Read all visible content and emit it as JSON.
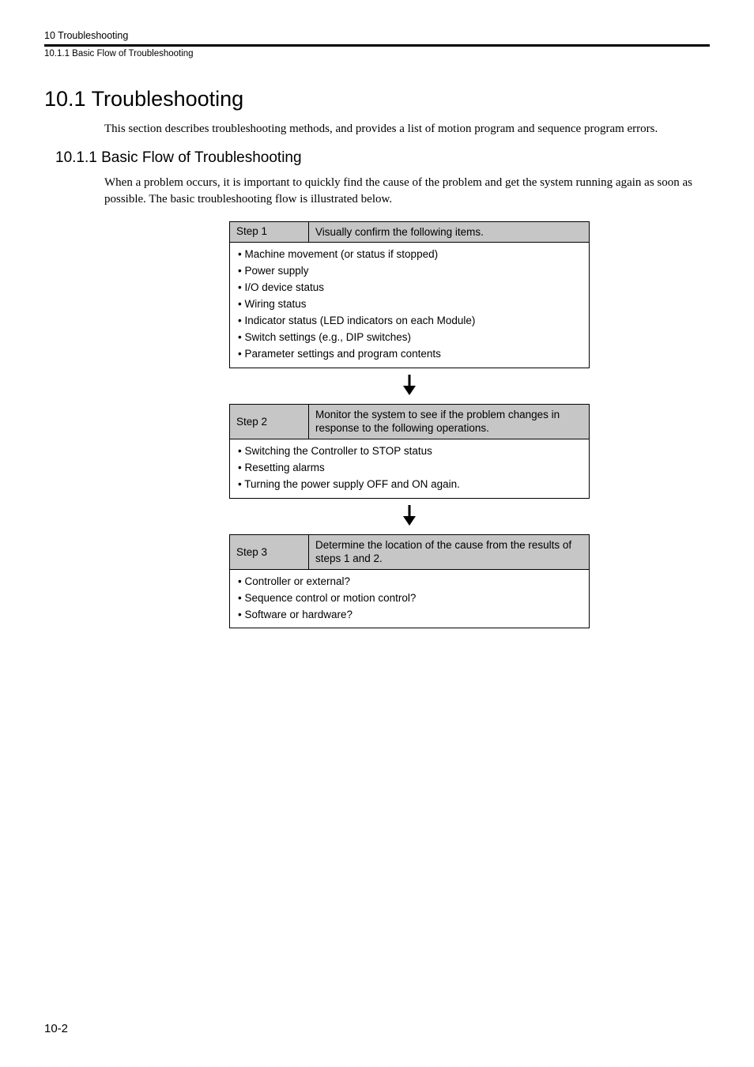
{
  "header": {
    "chapter": "10  Troubleshooting",
    "subsection": "10.1.1  Basic Flow of Troubleshooting"
  },
  "section": {
    "title": "10.1  Troubleshooting",
    "intro": "This section describes troubleshooting methods, and provides a list of motion program and sequence program errors."
  },
  "subsection": {
    "title": "10.1.1  Basic Flow of Troubleshooting",
    "intro": "When a problem occurs, it is important to quickly find the cause of the problem and get the system running again as soon as possible. The basic troubleshooting flow is illustrated below."
  },
  "steps": [
    {
      "label": "Step 1",
      "desc": "Visually confirm the following items.",
      "items": [
        "• Machine movement (or status if stopped)",
        "• Power supply",
        "• I/O device status",
        "• Wiring status",
        "• Indicator status (LED indicators on each Module)",
        "• Switch settings (e.g., DIP switches)",
        "• Parameter settings and program contents"
      ]
    },
    {
      "label": "Step 2",
      "desc": "Monitor the system to see if the problem changes in response to the following operations.",
      "items": [
        "• Switching the Controller to STOP status",
        "• Resetting alarms",
        "• Turning the power supply OFF and ON again."
      ]
    },
    {
      "label": "Step 3",
      "desc": "Determine the location of the cause from the results of steps 1 and 2.",
      "items": [
        "• Controller or external?",
        "• Sequence control or motion control?",
        "• Software or hardware?"
      ]
    }
  ],
  "pageNum": "10-2"
}
